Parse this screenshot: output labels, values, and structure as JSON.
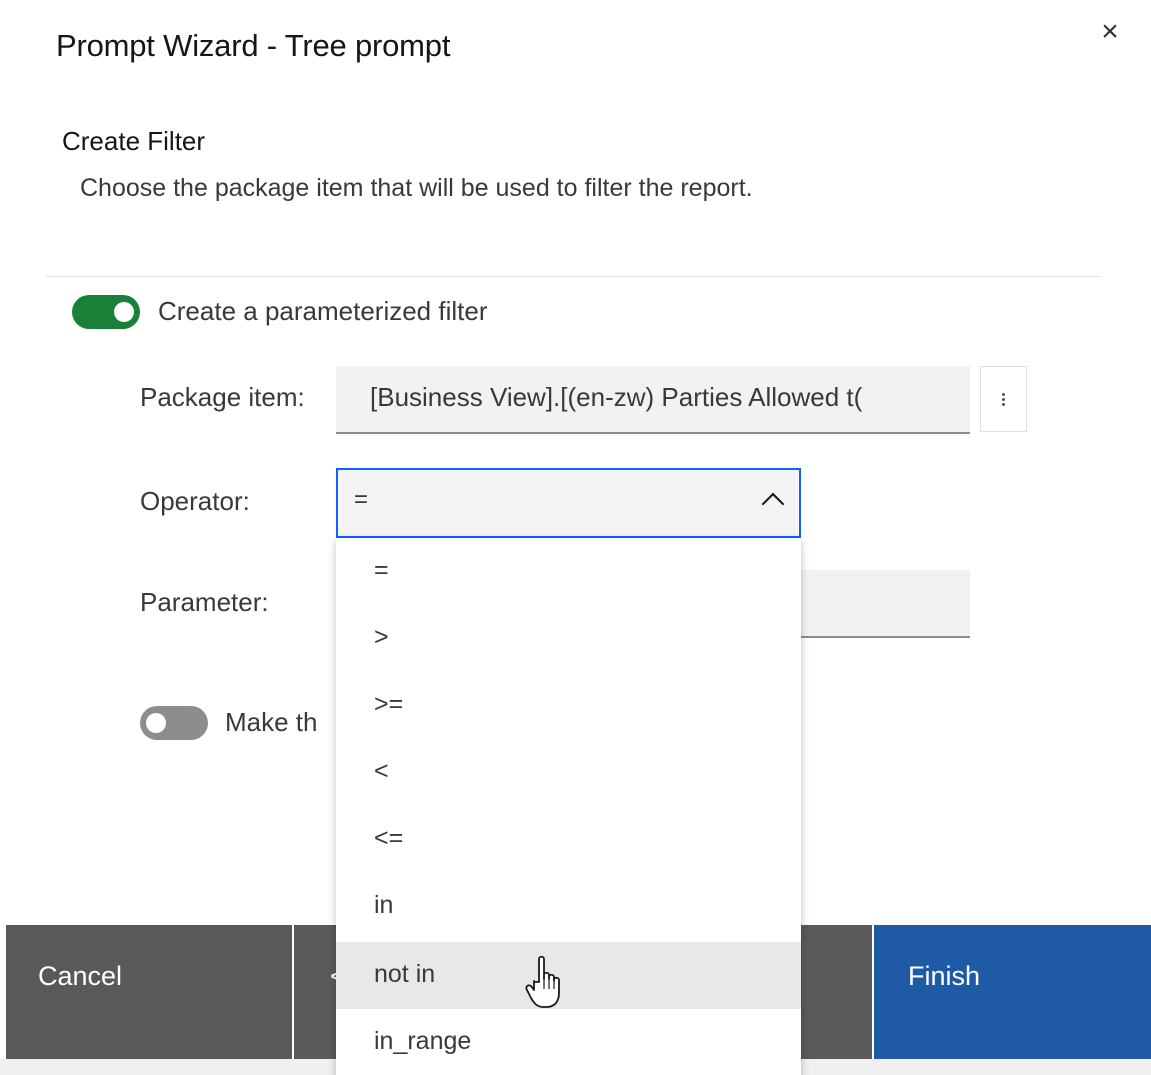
{
  "dialog": {
    "title": "Prompt Wizard - Tree prompt",
    "close_label": "×"
  },
  "section": {
    "title": "Create Filter",
    "description": "Choose the package item that will be used to filter the report."
  },
  "parameterized_toggle": {
    "label": "Create a parameterized filter",
    "state": "on"
  },
  "form": {
    "package_item_label": "Package item:",
    "package_item_value": "[Business View].[(en-zw) Parties Allowed t(",
    "operator_label": "Operator:",
    "operator_value": "=",
    "parameter_label": "Parameter:"
  },
  "optional_toggle": {
    "label": "Make th",
    "state": "off"
  },
  "operator_options": [
    "=",
    ">",
    ">=",
    "<",
    "<=",
    "in",
    "not in",
    "in_range"
  ],
  "hovered_option": "not in",
  "footer": {
    "cancel_label": "Cancel",
    "back_label": "<",
    "finish_label": "Finish"
  },
  "colors": {
    "toggle_on": "#198038",
    "toggle_off": "#8d8d8d",
    "focus_border": "#0f62fe",
    "finish_button": "#1f5aa6",
    "secondary_button": "#595959"
  }
}
